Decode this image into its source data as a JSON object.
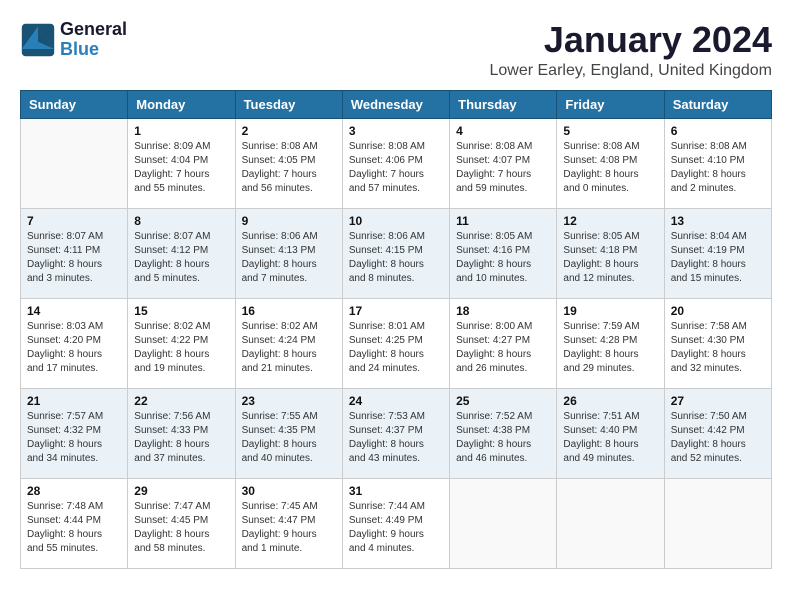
{
  "logo": {
    "line1": "General",
    "line2": "Blue"
  },
  "title": "January 2024",
  "subtitle": "Lower Earley, England, United Kingdom",
  "header_days": [
    "Sunday",
    "Monday",
    "Tuesday",
    "Wednesday",
    "Thursday",
    "Friday",
    "Saturday"
  ],
  "weeks": [
    {
      "shaded": false,
      "days": [
        {
          "num": "",
          "detail": ""
        },
        {
          "num": "1",
          "detail": "Sunrise: 8:09 AM\nSunset: 4:04 PM\nDaylight: 7 hours\nand 55 minutes."
        },
        {
          "num": "2",
          "detail": "Sunrise: 8:08 AM\nSunset: 4:05 PM\nDaylight: 7 hours\nand 56 minutes."
        },
        {
          "num": "3",
          "detail": "Sunrise: 8:08 AM\nSunset: 4:06 PM\nDaylight: 7 hours\nand 57 minutes."
        },
        {
          "num": "4",
          "detail": "Sunrise: 8:08 AM\nSunset: 4:07 PM\nDaylight: 7 hours\nand 59 minutes."
        },
        {
          "num": "5",
          "detail": "Sunrise: 8:08 AM\nSunset: 4:08 PM\nDaylight: 8 hours\nand 0 minutes."
        },
        {
          "num": "6",
          "detail": "Sunrise: 8:08 AM\nSunset: 4:10 PM\nDaylight: 8 hours\nand 2 minutes."
        }
      ]
    },
    {
      "shaded": true,
      "days": [
        {
          "num": "7",
          "detail": "Sunrise: 8:07 AM\nSunset: 4:11 PM\nDaylight: 8 hours\nand 3 minutes."
        },
        {
          "num": "8",
          "detail": "Sunrise: 8:07 AM\nSunset: 4:12 PM\nDaylight: 8 hours\nand 5 minutes."
        },
        {
          "num": "9",
          "detail": "Sunrise: 8:06 AM\nSunset: 4:13 PM\nDaylight: 8 hours\nand 7 minutes."
        },
        {
          "num": "10",
          "detail": "Sunrise: 8:06 AM\nSunset: 4:15 PM\nDaylight: 8 hours\nand 8 minutes."
        },
        {
          "num": "11",
          "detail": "Sunrise: 8:05 AM\nSunset: 4:16 PM\nDaylight: 8 hours\nand 10 minutes."
        },
        {
          "num": "12",
          "detail": "Sunrise: 8:05 AM\nSunset: 4:18 PM\nDaylight: 8 hours\nand 12 minutes."
        },
        {
          "num": "13",
          "detail": "Sunrise: 8:04 AM\nSunset: 4:19 PM\nDaylight: 8 hours\nand 15 minutes."
        }
      ]
    },
    {
      "shaded": false,
      "days": [
        {
          "num": "14",
          "detail": "Sunrise: 8:03 AM\nSunset: 4:20 PM\nDaylight: 8 hours\nand 17 minutes."
        },
        {
          "num": "15",
          "detail": "Sunrise: 8:02 AM\nSunset: 4:22 PM\nDaylight: 8 hours\nand 19 minutes."
        },
        {
          "num": "16",
          "detail": "Sunrise: 8:02 AM\nSunset: 4:24 PM\nDaylight: 8 hours\nand 21 minutes."
        },
        {
          "num": "17",
          "detail": "Sunrise: 8:01 AM\nSunset: 4:25 PM\nDaylight: 8 hours\nand 24 minutes."
        },
        {
          "num": "18",
          "detail": "Sunrise: 8:00 AM\nSunset: 4:27 PM\nDaylight: 8 hours\nand 26 minutes."
        },
        {
          "num": "19",
          "detail": "Sunrise: 7:59 AM\nSunset: 4:28 PM\nDaylight: 8 hours\nand 29 minutes."
        },
        {
          "num": "20",
          "detail": "Sunrise: 7:58 AM\nSunset: 4:30 PM\nDaylight: 8 hours\nand 32 minutes."
        }
      ]
    },
    {
      "shaded": true,
      "days": [
        {
          "num": "21",
          "detail": "Sunrise: 7:57 AM\nSunset: 4:32 PM\nDaylight: 8 hours\nand 34 minutes."
        },
        {
          "num": "22",
          "detail": "Sunrise: 7:56 AM\nSunset: 4:33 PM\nDaylight: 8 hours\nand 37 minutes."
        },
        {
          "num": "23",
          "detail": "Sunrise: 7:55 AM\nSunset: 4:35 PM\nDaylight: 8 hours\nand 40 minutes."
        },
        {
          "num": "24",
          "detail": "Sunrise: 7:53 AM\nSunset: 4:37 PM\nDaylight: 8 hours\nand 43 minutes."
        },
        {
          "num": "25",
          "detail": "Sunrise: 7:52 AM\nSunset: 4:38 PM\nDaylight: 8 hours\nand 46 minutes."
        },
        {
          "num": "26",
          "detail": "Sunrise: 7:51 AM\nSunset: 4:40 PM\nDaylight: 8 hours\nand 49 minutes."
        },
        {
          "num": "27",
          "detail": "Sunrise: 7:50 AM\nSunset: 4:42 PM\nDaylight: 8 hours\nand 52 minutes."
        }
      ]
    },
    {
      "shaded": false,
      "days": [
        {
          "num": "28",
          "detail": "Sunrise: 7:48 AM\nSunset: 4:44 PM\nDaylight: 8 hours\nand 55 minutes."
        },
        {
          "num": "29",
          "detail": "Sunrise: 7:47 AM\nSunset: 4:45 PM\nDaylight: 8 hours\nand 58 minutes."
        },
        {
          "num": "30",
          "detail": "Sunrise: 7:45 AM\nSunset: 4:47 PM\nDaylight: 9 hours\nand 1 minute."
        },
        {
          "num": "31",
          "detail": "Sunrise: 7:44 AM\nSunset: 4:49 PM\nDaylight: 9 hours\nand 4 minutes."
        },
        {
          "num": "",
          "detail": ""
        },
        {
          "num": "",
          "detail": ""
        },
        {
          "num": "",
          "detail": ""
        }
      ]
    }
  ]
}
